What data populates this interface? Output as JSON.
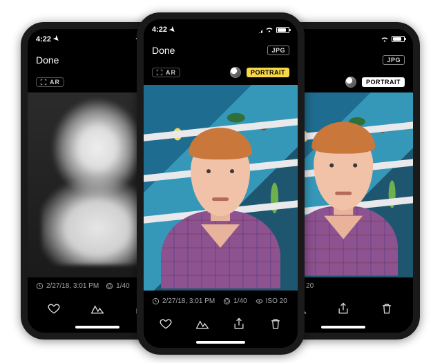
{
  "status": {
    "time": "4:22",
    "location_arrow": true
  },
  "nav": {
    "done": "Done",
    "format_jpg": "JPG"
  },
  "topbar": {
    "ar_label": "AR",
    "mode_portrait": "PORTRAIT"
  },
  "meta": {
    "timestamp": "2/27/18, 3:01 PM",
    "shutter": "1/40",
    "iso": "ISO 20"
  },
  "icons": {
    "heart": "heart-icon",
    "levels": "levels-icon",
    "share": "share-icon",
    "trash": "trash-icon",
    "eye": "eye-icon",
    "aperture": "aperture-icon",
    "clock": "clock-icon"
  }
}
